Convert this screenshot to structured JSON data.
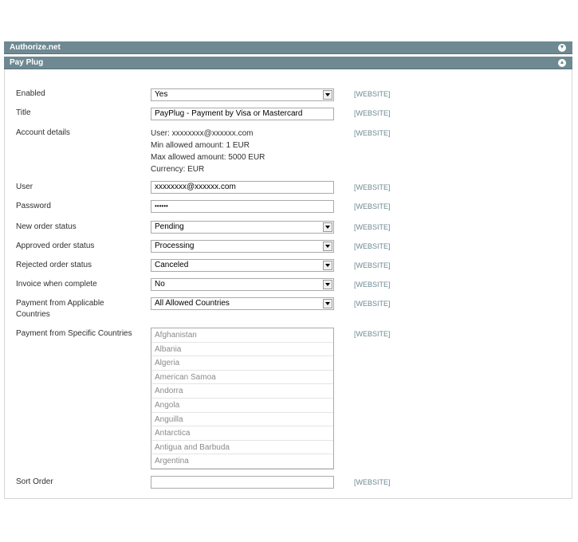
{
  "sections": {
    "authorize": {
      "title": "Authorize.net"
    },
    "payplug": {
      "title": "Pay Plug"
    }
  },
  "scope_label": "[WEBSITE]",
  "fields": {
    "enabled": {
      "label": "Enabled",
      "value": "Yes"
    },
    "title": {
      "label": "Title",
      "value": "PayPlug - Payment by Visa or Mastercard"
    },
    "account": {
      "label": "Account details",
      "lines": [
        "User: xxxxxxxx@xxxxxx.com",
        "Min allowed amount: 1 EUR",
        "Max allowed amount: 5000 EUR",
        "Currency: EUR"
      ]
    },
    "user": {
      "label": "User",
      "value": "xxxxxxxx@xxxxxx.com"
    },
    "password": {
      "label": "Password",
      "value": "••••••"
    },
    "new_status": {
      "label": "New order status",
      "value": "Pending"
    },
    "approved_status": {
      "label": "Approved order status",
      "value": "Processing"
    },
    "rejected_status": {
      "label": "Rejected order status",
      "value": "Canceled"
    },
    "invoice": {
      "label": "Invoice when complete",
      "value": "No"
    },
    "applicable": {
      "label_line1": "Payment from Applicable",
      "label_line2": "Countries",
      "value": "All Allowed Countries"
    },
    "specific": {
      "label": "Payment from Specific Countries",
      "options": [
        "Afghanistan",
        "Albania",
        "Algeria",
        "American Samoa",
        "Andorra",
        "Angola",
        "Anguilla",
        "Antarctica",
        "Antigua and Barbuda",
        "Argentina"
      ]
    },
    "sort_order": {
      "label": "Sort Order",
      "value": ""
    }
  }
}
